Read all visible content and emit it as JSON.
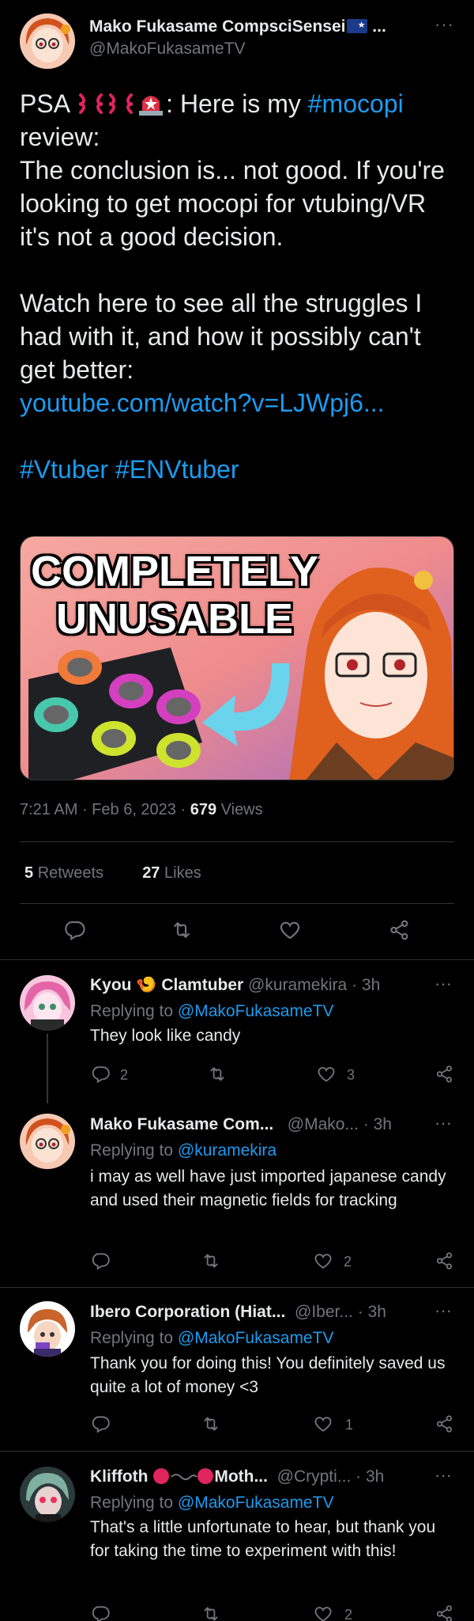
{
  "main_tweet": {
    "author_name": "Mako Fukasame CompsciSensei",
    "author_name_suffix": " ...",
    "author_handle": "@MakoFukasameTV",
    "more_label": "···",
    "text_psa": "PSA ",
    "text_after_emoji": ": Here is my ",
    "hashtag_mocopi": "#mocopi",
    "text_body": " review:\nThe conclusion is... not good. If you're looking to get mocopi for vtubing/VR it's not a good decision.\n\nWatch here to see all the struggles I had with it, and how it possibly can't get better:\n",
    "link": "youtube.com/watch?v=LJWpj6...",
    "hashtag_vtuber": "#Vtuber",
    "hashtag_envtuber": "#ENVtuber",
    "thumbnail_line1": "COMPLETELY",
    "thumbnail_line2": "UNUSABLE",
    "time": "7:21 AM",
    "date": "Feb 6, 2023",
    "views_count": "679",
    "views_label": "Views",
    "retweets_count": "5",
    "retweets_label": "Retweets",
    "likes_count": "27",
    "likes_label": "Likes"
  },
  "replies": [
    {
      "name": "Kyou",
      "name_emoji": "🍤",
      "name_rest": "Clamtuber",
      "handle": "@kuramekira",
      "time": "· 3h",
      "replying_label": "Replying to ",
      "replying_to": "@MakoFukasameTV",
      "text": "They look like candy",
      "reply_count": "2",
      "retweet_count": "",
      "like_count": "3"
    },
    {
      "name": "Mako Fukasame Com...",
      "handle": "@Mako...",
      "time": "· 3h",
      "replying_label": "Replying to ",
      "replying_to": "@kuramekira",
      "text": "i may as well have just imported japanese candy and used their magnetic fields for tracking",
      "reply_count": "",
      "retweet_count": "",
      "like_count": "2"
    },
    {
      "name": "Ibero Corporation (Hiat...",
      "handle": "@Iber...",
      "time": "· 3h",
      "replying_label": "Replying to ",
      "replying_to": "@MakoFukasameTV",
      "text": "Thank you for doing this! You definitely saved us quite a lot of money <3",
      "reply_count": "",
      "retweet_count": "",
      "like_count": "1"
    },
    {
      "name": "Kliffoth",
      "name_rest": "Moth...",
      "handle": "@Crypti...",
      "time": "· 3h",
      "replying_label": "Replying to ",
      "replying_to": "@MakoFukasameTV",
      "text": "That's a little unfortunate to hear, but thank you for taking the time to experiment with this!",
      "reply_count": "",
      "retweet_count": "",
      "like_count": "2"
    }
  ],
  "colors": {
    "background": "#000000",
    "text": "#e7e9ea",
    "muted": "#71767b",
    "link": "#1d9bf0",
    "divider": "#2f3336"
  }
}
